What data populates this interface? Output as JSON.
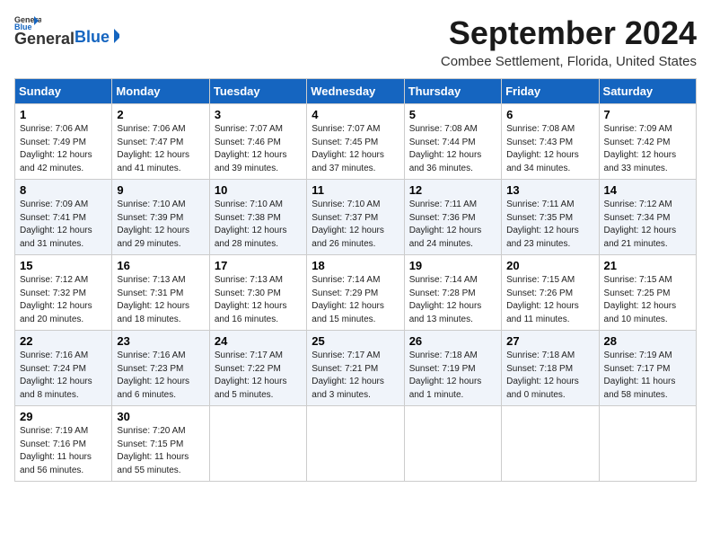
{
  "header": {
    "logo_line1": "General",
    "logo_line2": "Blue",
    "month_title": "September 2024",
    "location": "Combee Settlement, Florida, United States"
  },
  "days_of_week": [
    "Sunday",
    "Monday",
    "Tuesday",
    "Wednesday",
    "Thursday",
    "Friday",
    "Saturday"
  ],
  "weeks": [
    [
      {
        "day": "1",
        "info": "Sunrise: 7:06 AM\nSunset: 7:49 PM\nDaylight: 12 hours\nand 42 minutes."
      },
      {
        "day": "2",
        "info": "Sunrise: 7:06 AM\nSunset: 7:47 PM\nDaylight: 12 hours\nand 41 minutes."
      },
      {
        "day": "3",
        "info": "Sunrise: 7:07 AM\nSunset: 7:46 PM\nDaylight: 12 hours\nand 39 minutes."
      },
      {
        "day": "4",
        "info": "Sunrise: 7:07 AM\nSunset: 7:45 PM\nDaylight: 12 hours\nand 37 minutes."
      },
      {
        "day": "5",
        "info": "Sunrise: 7:08 AM\nSunset: 7:44 PM\nDaylight: 12 hours\nand 36 minutes."
      },
      {
        "day": "6",
        "info": "Sunrise: 7:08 AM\nSunset: 7:43 PM\nDaylight: 12 hours\nand 34 minutes."
      },
      {
        "day": "7",
        "info": "Sunrise: 7:09 AM\nSunset: 7:42 PM\nDaylight: 12 hours\nand 33 minutes."
      }
    ],
    [
      {
        "day": "8",
        "info": "Sunrise: 7:09 AM\nSunset: 7:41 PM\nDaylight: 12 hours\nand 31 minutes."
      },
      {
        "day": "9",
        "info": "Sunrise: 7:10 AM\nSunset: 7:39 PM\nDaylight: 12 hours\nand 29 minutes."
      },
      {
        "day": "10",
        "info": "Sunrise: 7:10 AM\nSunset: 7:38 PM\nDaylight: 12 hours\nand 28 minutes."
      },
      {
        "day": "11",
        "info": "Sunrise: 7:10 AM\nSunset: 7:37 PM\nDaylight: 12 hours\nand 26 minutes."
      },
      {
        "day": "12",
        "info": "Sunrise: 7:11 AM\nSunset: 7:36 PM\nDaylight: 12 hours\nand 24 minutes."
      },
      {
        "day": "13",
        "info": "Sunrise: 7:11 AM\nSunset: 7:35 PM\nDaylight: 12 hours\nand 23 minutes."
      },
      {
        "day": "14",
        "info": "Sunrise: 7:12 AM\nSunset: 7:34 PM\nDaylight: 12 hours\nand 21 minutes."
      }
    ],
    [
      {
        "day": "15",
        "info": "Sunrise: 7:12 AM\nSunset: 7:32 PM\nDaylight: 12 hours\nand 20 minutes."
      },
      {
        "day": "16",
        "info": "Sunrise: 7:13 AM\nSunset: 7:31 PM\nDaylight: 12 hours\nand 18 minutes."
      },
      {
        "day": "17",
        "info": "Sunrise: 7:13 AM\nSunset: 7:30 PM\nDaylight: 12 hours\nand 16 minutes."
      },
      {
        "day": "18",
        "info": "Sunrise: 7:14 AM\nSunset: 7:29 PM\nDaylight: 12 hours\nand 15 minutes."
      },
      {
        "day": "19",
        "info": "Sunrise: 7:14 AM\nSunset: 7:28 PM\nDaylight: 12 hours\nand 13 minutes."
      },
      {
        "day": "20",
        "info": "Sunrise: 7:15 AM\nSunset: 7:26 PM\nDaylight: 12 hours\nand 11 minutes."
      },
      {
        "day": "21",
        "info": "Sunrise: 7:15 AM\nSunset: 7:25 PM\nDaylight: 12 hours\nand 10 minutes."
      }
    ],
    [
      {
        "day": "22",
        "info": "Sunrise: 7:16 AM\nSunset: 7:24 PM\nDaylight: 12 hours\nand 8 minutes."
      },
      {
        "day": "23",
        "info": "Sunrise: 7:16 AM\nSunset: 7:23 PM\nDaylight: 12 hours\nand 6 minutes."
      },
      {
        "day": "24",
        "info": "Sunrise: 7:17 AM\nSunset: 7:22 PM\nDaylight: 12 hours\nand 5 minutes."
      },
      {
        "day": "25",
        "info": "Sunrise: 7:17 AM\nSunset: 7:21 PM\nDaylight: 12 hours\nand 3 minutes."
      },
      {
        "day": "26",
        "info": "Sunrise: 7:18 AM\nSunset: 7:19 PM\nDaylight: 12 hours\nand 1 minute."
      },
      {
        "day": "27",
        "info": "Sunrise: 7:18 AM\nSunset: 7:18 PM\nDaylight: 12 hours\nand 0 minutes."
      },
      {
        "day": "28",
        "info": "Sunrise: 7:19 AM\nSunset: 7:17 PM\nDaylight: 11 hours\nand 58 minutes."
      }
    ],
    [
      {
        "day": "29",
        "info": "Sunrise: 7:19 AM\nSunset: 7:16 PM\nDaylight: 11 hours\nand 56 minutes."
      },
      {
        "day": "30",
        "info": "Sunrise: 7:20 AM\nSunset: 7:15 PM\nDaylight: 11 hours\nand 55 minutes."
      },
      {
        "day": "",
        "info": ""
      },
      {
        "day": "",
        "info": ""
      },
      {
        "day": "",
        "info": ""
      },
      {
        "day": "",
        "info": ""
      },
      {
        "day": "",
        "info": ""
      }
    ]
  ]
}
